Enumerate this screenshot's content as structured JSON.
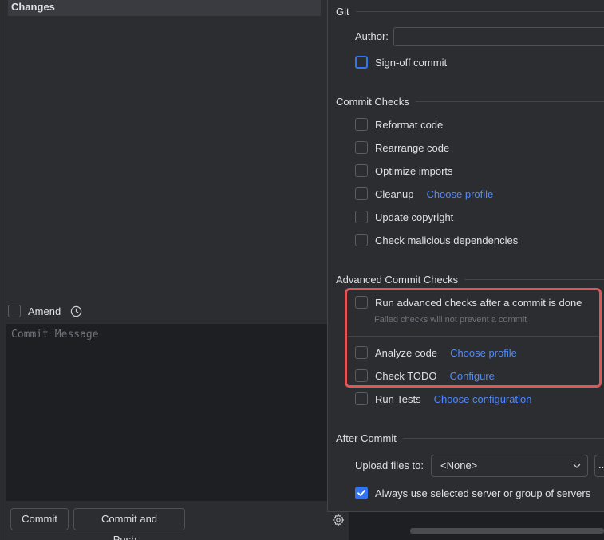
{
  "left": {
    "changes_header": "Changes",
    "amend_label": "Amend",
    "message_placeholder": "Commit Message",
    "commit_button": "Commit",
    "commit_push_button": "Commit and Push..."
  },
  "git": {
    "title": "Git",
    "author_label": "Author:",
    "author_value": "",
    "signoff_label": "Sign-off commit"
  },
  "commit_checks": {
    "title": "Commit Checks",
    "items": [
      {
        "label": "Reformat code",
        "link": ""
      },
      {
        "label": "Rearrange code",
        "link": ""
      },
      {
        "label": "Optimize imports",
        "link": ""
      },
      {
        "label": "Cleanup",
        "link": "Choose profile"
      },
      {
        "label": "Update copyright",
        "link": ""
      },
      {
        "label": "Check malicious dependencies",
        "link": ""
      }
    ]
  },
  "advanced": {
    "title": "Advanced Commit Checks",
    "run_after_label": "Run advanced checks after a commit is done",
    "failed_note": "Failed checks will not prevent a commit",
    "analyze_label": "Analyze code",
    "analyze_link": "Choose profile",
    "todo_label": "Check TODO",
    "todo_link": "Configure",
    "tests_label": "Run Tests",
    "tests_link": "Choose configuration"
  },
  "after_commit": {
    "title": "After Commit",
    "upload_label": "Upload files to:",
    "upload_value": "<None>",
    "more_button": "...",
    "always_label": "Always use selected server or group of servers",
    "always_checked": true
  },
  "colors": {
    "accent": "#3574f0",
    "link": "#548af7",
    "highlight": "#e05555"
  }
}
